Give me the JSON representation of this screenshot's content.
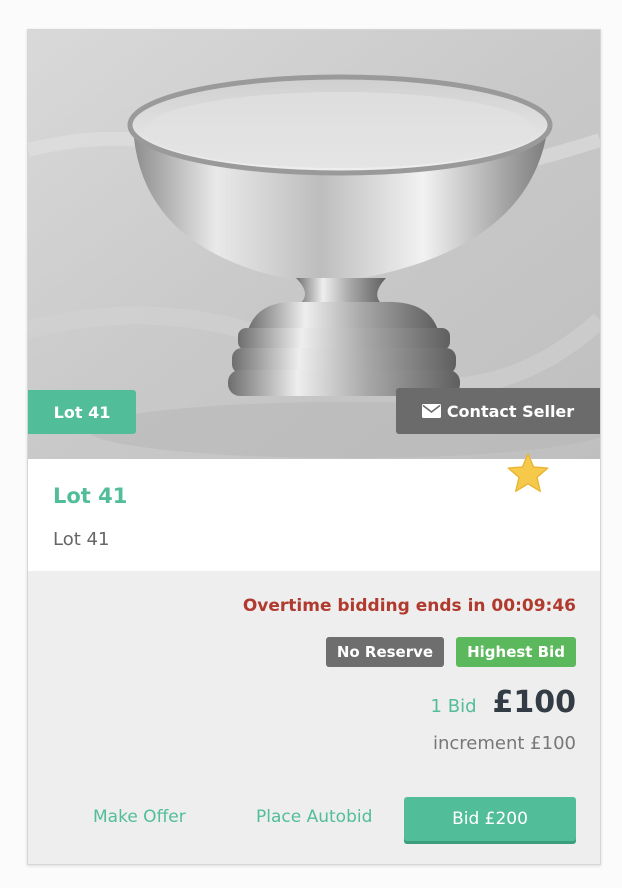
{
  "colors": {
    "accent": "#52bd99",
    "timer": "#b03a2e",
    "badge_grey": "#6e6e6e",
    "badge_green": "#5cb85c",
    "star": "#f7c94a"
  },
  "media": {
    "alt": "Silver footed bowl",
    "lot_badge": "Lot 41",
    "contact_label": "Contact Seller",
    "contact_icon": "envelope-icon"
  },
  "lot": {
    "title": "Lot 41",
    "subtitle": "Lot 41",
    "favorite_icon": "star-icon"
  },
  "bidding": {
    "timer_text": "Overtime bidding ends in 00:09:46",
    "badges": [
      "No Reserve",
      "Highest Bid"
    ],
    "bid_count": "1 Bid",
    "price": "£100",
    "increment": "increment £100"
  },
  "actions": {
    "make_offer": "Make Offer",
    "place_autobid": "Place Autobid",
    "bid_button": "Bid £200"
  }
}
